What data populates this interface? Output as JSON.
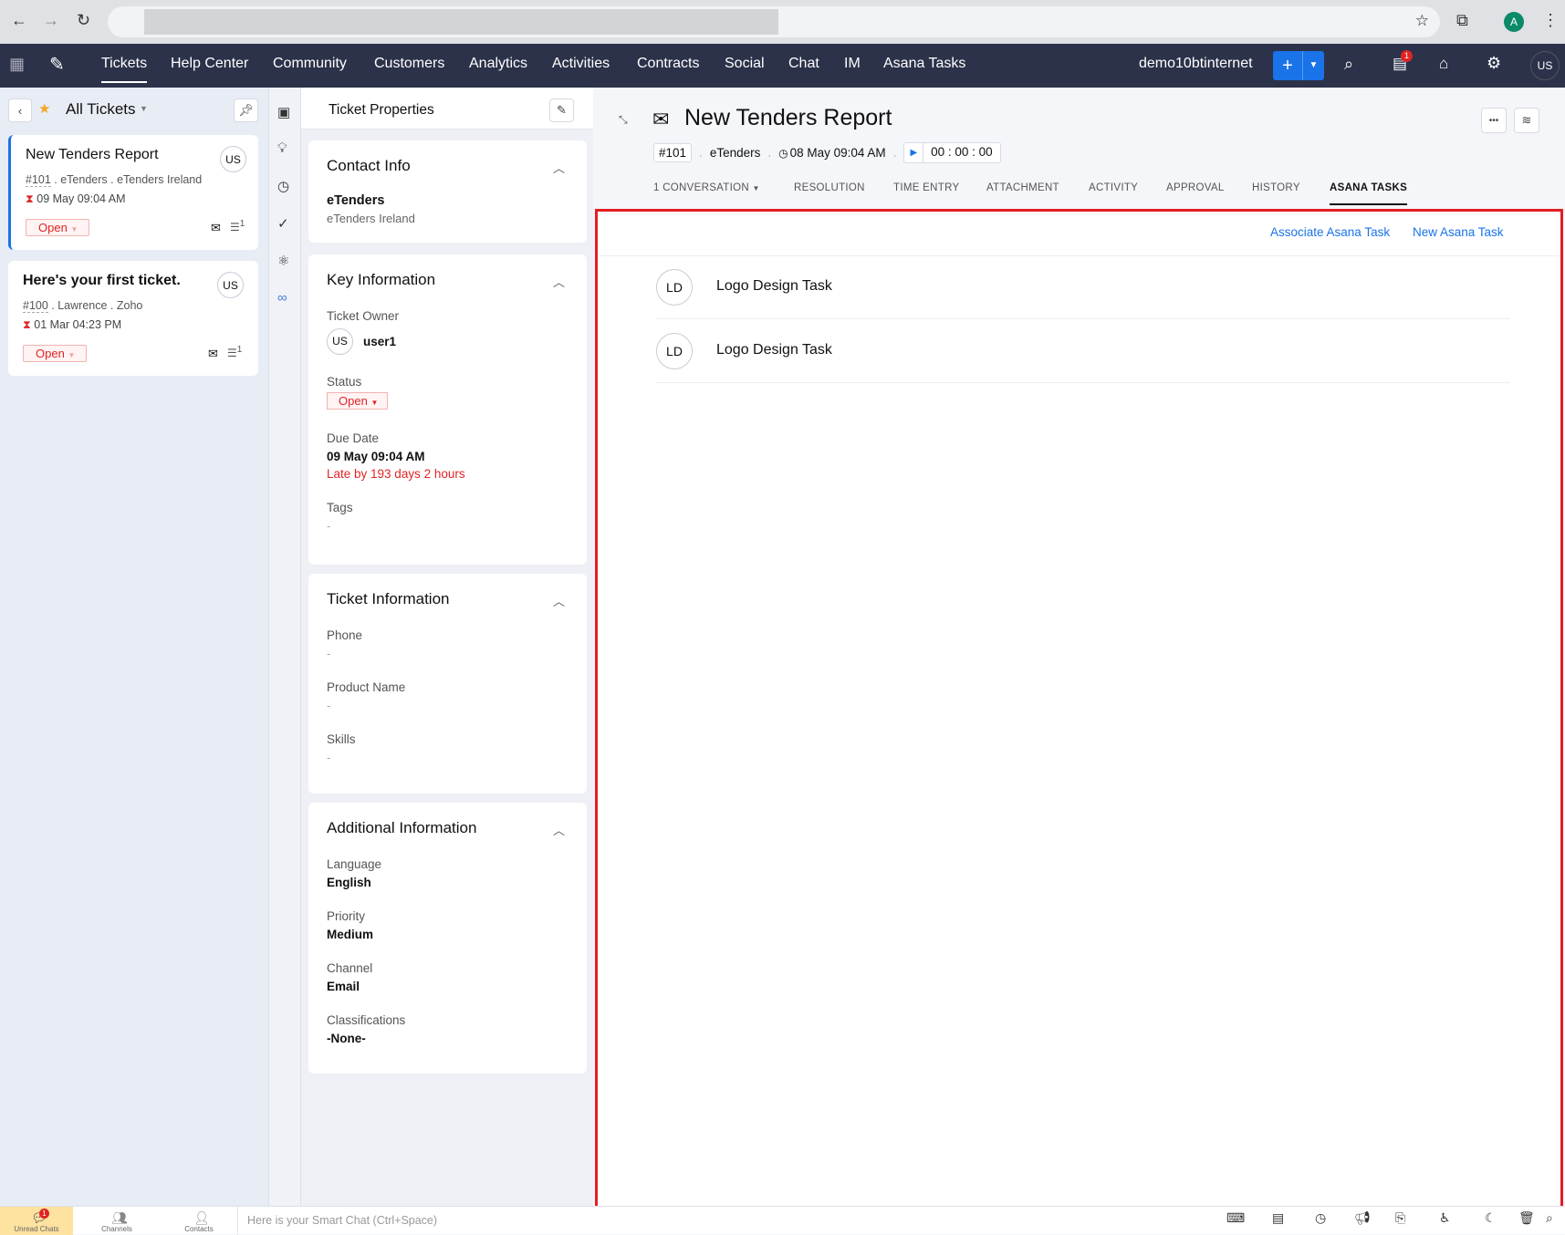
{
  "browser": {
    "back": "←",
    "forward": "→",
    "reload": "↻",
    "profile": "A"
  },
  "nav": {
    "items": [
      "Tickets",
      "Help Center",
      "Community",
      "Customers",
      "Analytics",
      "Activities",
      "Contracts",
      "Social",
      "Chat",
      "IM",
      "Asana Tasks"
    ],
    "org": "demo10btinternet",
    "notif_count": "1",
    "user": "US"
  },
  "list": {
    "view": "All Tickets",
    "tickets": [
      {
        "subject": "New Tenders Report",
        "id": "#101",
        "contact": "eTenders",
        "account": "eTenders Ireland",
        "due": "09 May 09:04 AM",
        "status": "Open",
        "owner": "US",
        "threads": "1"
      },
      {
        "subject": "Here's your first ticket.",
        "id": "#100",
        "contact": "Lawrence",
        "account": "Zoho",
        "due": "01 Mar 04:23 PM",
        "status": "Open",
        "owner": "US",
        "threads": "1"
      }
    ]
  },
  "props": {
    "title": "Ticket Properties",
    "contact": {
      "heading": "Contact Info",
      "name": "eTenders",
      "account": "eTenders Ireland"
    },
    "key": {
      "heading": "Key Information",
      "owner_label": "Ticket Owner",
      "owner_initials": "US",
      "owner": "user1",
      "status_label": "Status",
      "status": "Open",
      "due_label": "Due Date",
      "due": "09 May 09:04 AM",
      "late": "Late by 193 days 2 hours",
      "tags_label": "Tags",
      "tags": "-"
    },
    "info": {
      "heading": "Ticket Information",
      "phone_label": "Phone",
      "phone": "-",
      "product_label": "Product Name",
      "product": "-",
      "skills_label": "Skills",
      "skills": "-"
    },
    "additional": {
      "heading": "Additional Information",
      "language_label": "Language",
      "language": "English",
      "priority_label": "Priority",
      "priority": "Medium",
      "channel_label": "Channel",
      "channel": "Email",
      "class_label": "Classifications",
      "class": "-None-"
    }
  },
  "ticket": {
    "title": "New Tenders Report",
    "id": "#101",
    "contact": "eTenders",
    "created": "08 May 09:04 AM",
    "timer": "00 : 00 : 00",
    "tabs": [
      "1 CONVERSATION",
      "RESOLUTION",
      "TIME ENTRY",
      "ATTACHMENT",
      "ACTIVITY",
      "APPROVAL",
      "HISTORY",
      "ASANA TASKS"
    ]
  },
  "asana": {
    "associate": "Associate Asana Task",
    "new": "New Asana Task",
    "tasks": [
      {
        "initials": "LD",
        "name": "Logo Design Task"
      },
      {
        "initials": "LD",
        "name": "Logo Design Task"
      }
    ]
  },
  "bottom": {
    "unread": "Unread Chats",
    "unread_count": "1",
    "channels": "Channels",
    "contacts": "Contacts",
    "smartchat": "Here is your Smart Chat (Ctrl+Space)"
  },
  "colors": {
    "nav": "#2b3249",
    "accent": "#1a73e8",
    "danger": "#e02424"
  }
}
